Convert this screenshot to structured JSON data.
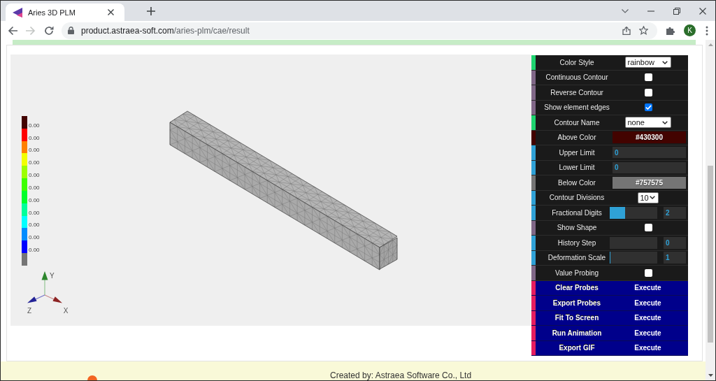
{
  "browser": {
    "tab": {
      "title": "Aries 3D PLM",
      "selected": true
    },
    "navigation": [
      {
        "kind": "back",
        "disabled": false
      },
      {
        "kind": "forward",
        "disabled": true
      },
      {
        "kind": "reload",
        "disabled": false
      }
    ],
    "address": {
      "host": "product.astraea-soft.com",
      "path": "/aries-plm/cae/result"
    },
    "profile": {
      "initial": "K"
    }
  },
  "viewer": {
    "legend": [
      {
        "color": "#430300",
        "label": "0.00"
      },
      {
        "color": "#ff0000",
        "label": "0.00"
      },
      {
        "color": "#ff8000",
        "label": "0.00"
      },
      {
        "color": "#f2ff00",
        "label": "0.00"
      },
      {
        "color": "#9dff00",
        "label": "0.00"
      },
      {
        "color": "#3cff00",
        "label": "0.00"
      },
      {
        "color": "#00ff2a",
        "label": "0.00"
      },
      {
        "color": "#00ff9a",
        "label": "0.00"
      },
      {
        "color": "#00ffff",
        "label": "0.00"
      },
      {
        "color": "#008cff",
        "label": "0.00"
      },
      {
        "color": "#0000ff",
        "label": "0.00"
      },
      {
        "color": "#757575"
      }
    ],
    "axes": [
      {
        "kind": "y",
        "label": "Y"
      },
      {
        "kind": "z",
        "label": "Z"
      },
      {
        "kind": "x",
        "label": "X"
      }
    ]
  },
  "controls": [
    {
      "kind": "select",
      "label": "Color Style",
      "value": "rainbow"
    },
    {
      "kind": "checkbox",
      "label": "Continuous Contour",
      "checked": false
    },
    {
      "kind": "checkbox",
      "label": "Reverse Contour",
      "checked": false
    },
    {
      "kind": "checkbox",
      "label": "Show element edges",
      "checked": true
    },
    {
      "kind": "select",
      "label": "Contour Name",
      "value": "none"
    },
    {
      "kind": "color",
      "label": "Above Color",
      "value": "#430300",
      "color": "#430300"
    },
    {
      "kind": "number",
      "label": "Upper Limit",
      "value": "0"
    },
    {
      "kind": "number",
      "label": "Lower Limit",
      "value": "0"
    },
    {
      "kind": "color",
      "label": "Below Color",
      "value": "#757575",
      "color": "#757575"
    },
    {
      "kind": "numselect",
      "label": "Contour Divisions",
      "value": "10"
    },
    {
      "kind": "slider",
      "label": "Fractional Digits",
      "level": 0.33,
      "value": "2"
    },
    {
      "kind": "checkbox",
      "label": "Show Shape",
      "checked": false
    },
    {
      "kind": "slider",
      "label": "History Step",
      "value": "0"
    },
    {
      "kind": "slider",
      "label": "Deformation Scale",
      "level": 0.02,
      "value": "1"
    },
    {
      "kind": "checkbox",
      "label": "Value Probing",
      "checked": false
    },
    {
      "kind": "button",
      "label": "Clear Probes",
      "action": "Execute"
    },
    {
      "kind": "button",
      "label": "Export Probes",
      "action": "Execute"
    },
    {
      "kind": "button",
      "label": "Fit To Screen",
      "action": "Execute"
    },
    {
      "kind": "button",
      "label": "Run Animation",
      "action": "Execute"
    },
    {
      "kind": "button",
      "label": "Export GIF",
      "action": "Execute"
    }
  ],
  "footer": {
    "credit": "Created by: Astraea Software Co., Ltd"
  }
}
